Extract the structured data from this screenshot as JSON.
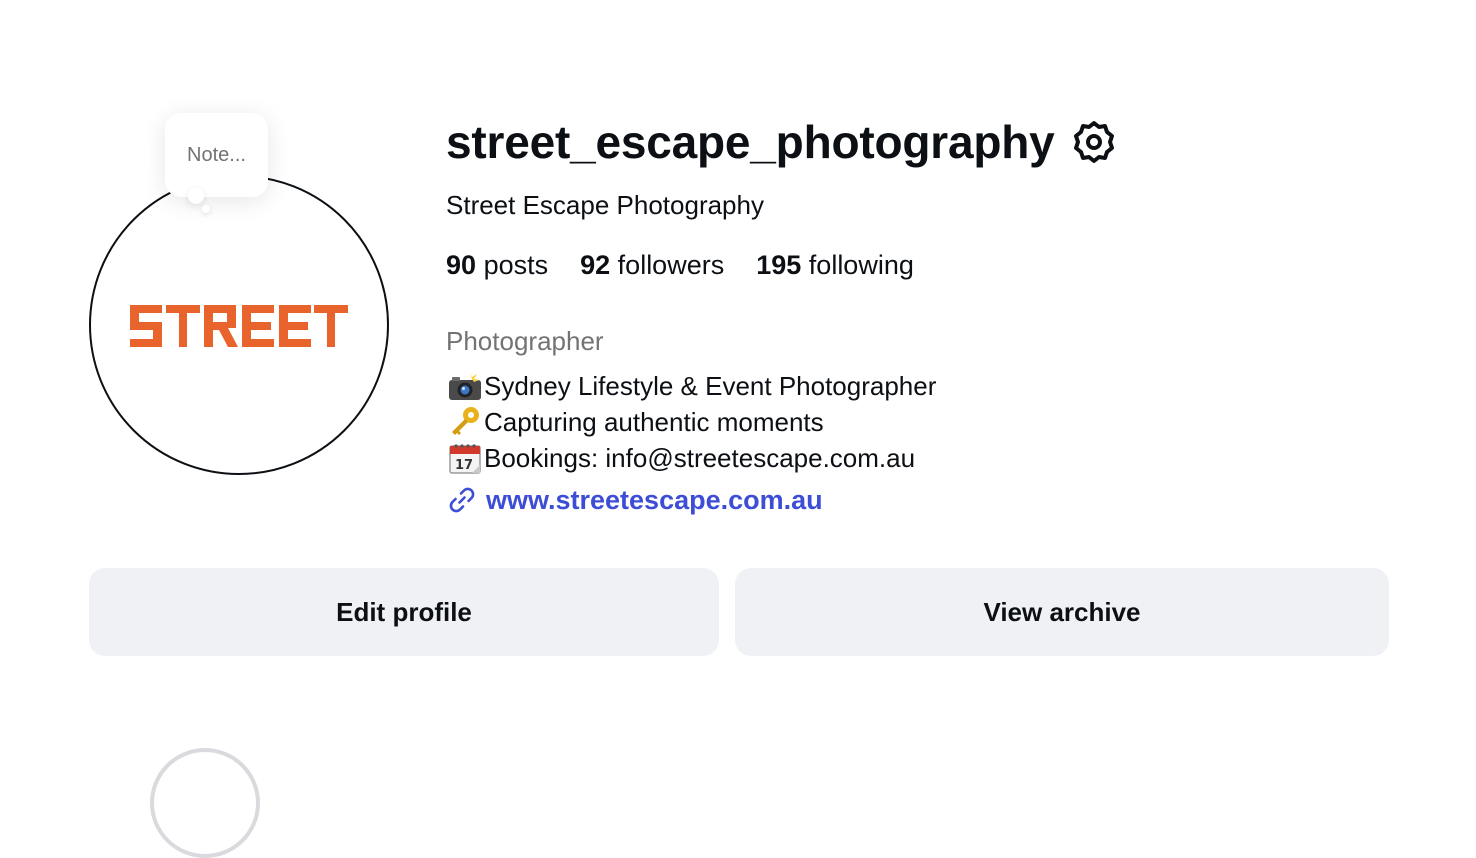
{
  "profile": {
    "username": "street_escape_photography",
    "display_name": "Street Escape Photography",
    "note_placeholder": "Note...",
    "avatar_logo_text": "STREET",
    "stats": {
      "posts_count": "90",
      "posts_label": "posts",
      "followers_count": "92",
      "followers_label": "followers",
      "following_count": "195",
      "following_label": "following"
    },
    "category": "Photographer",
    "bio_lines": [
      {
        "emoji": "camera-with-flash",
        "text": "Sydney Lifestyle & Event Photographer"
      },
      {
        "emoji": "key",
        "text": "Capturing authentic moments"
      },
      {
        "emoji": "spiral-calendar",
        "text": "Bookings: info@streetescape.com.au"
      }
    ],
    "website": "www.streetescape.com.au"
  },
  "actions": {
    "edit_profile_label": "Edit profile",
    "view_archive_label": "View archive"
  },
  "colors": {
    "text": "#0c1014",
    "secondary_text": "#737373",
    "link": "#3d4dd6",
    "button_bg": "#eff1f5",
    "logo_orange": "#e8642c"
  }
}
